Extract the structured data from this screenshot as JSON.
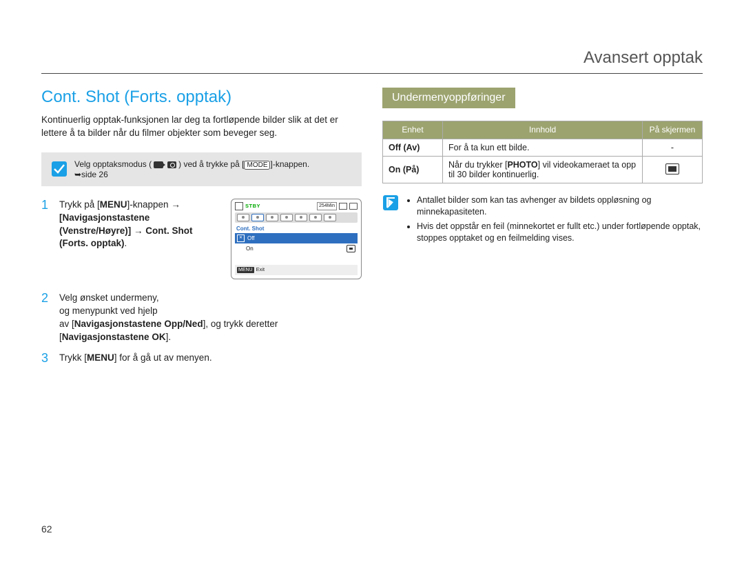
{
  "header": {
    "title": "Avansert opptak"
  },
  "page_number": "62",
  "left": {
    "section_title": "Cont. Shot (Forts. opptak)",
    "intro": "Kontinuerlig opptak-funksjonen lar deg ta fortløpende bilder slik at det er lettere å ta bilder når du filmer objekter som beveger seg.",
    "note": {
      "pre": "Velg opptaksmodus (",
      "post": ") ved å trykke på [",
      "mode": "MODE",
      "end": "]-knappen.",
      "ref": "➥side 26"
    },
    "steps": [
      {
        "num": "1",
        "parts": {
          "t1": "Trykk på [",
          "menu": "MENU",
          "t2": "]-knappen ",
          "arrow1": "→",
          "nav": " [Navigasjonstastene (Venstre/Høyre)] ",
          "arrow2": "→",
          "target": " Cont. Shot (Forts. opptak)",
          "dot": "."
        }
      },
      {
        "num": "2",
        "parts": {
          "l1": "Velg ønsket undermeny,",
          "l2": "og menypunkt ved hjelp",
          "l3a": "av [",
          "nav1": "Navigasjonstastene Opp/Ned",
          "l3b": "], og trykk deretter",
          "l4a": "",
          "nav2": "Navigasjonstastene OK",
          "l4b": "]."
        }
      },
      {
        "num": "3",
        "parts": {
          "t1": "Trykk [",
          "menu": "MENU",
          "t2": "] for å gå ut av menyen."
        }
      }
    ],
    "screen": {
      "stby": "STBY",
      "counter": "254Min",
      "menu_label": "Cont. Shot",
      "options": [
        "Off",
        "On"
      ],
      "selected_index": 0,
      "exit_chip": "MENU",
      "exit_label": "Exit"
    }
  },
  "right": {
    "sub_header": "Undermenyoppføringer",
    "table": {
      "headers": [
        "Enhet",
        "Innhold",
        "På skjermen"
      ],
      "rows": [
        {
          "enhet": "Off (Av)",
          "innhold_pre": "For å ta kun ett bilde.",
          "innhold_bold": "",
          "innhold_post": "",
          "screen": "-"
        },
        {
          "enhet": "On (På)",
          "innhold_pre": "Når du trykker [",
          "innhold_bold": "PHOTO",
          "innhold_post": "] vil videokameraet ta opp til 30 bilder kontinuerlig.",
          "screen": "icon"
        }
      ]
    },
    "tips": [
      "Antallet bilder som kan tas avhenger av bildets oppløsning og minnekapasiteten.",
      "Hvis det oppstår en feil (minnekortet er fullt etc.) under fortløpende opptak, stoppes opptaket og en feilmelding vises."
    ]
  }
}
